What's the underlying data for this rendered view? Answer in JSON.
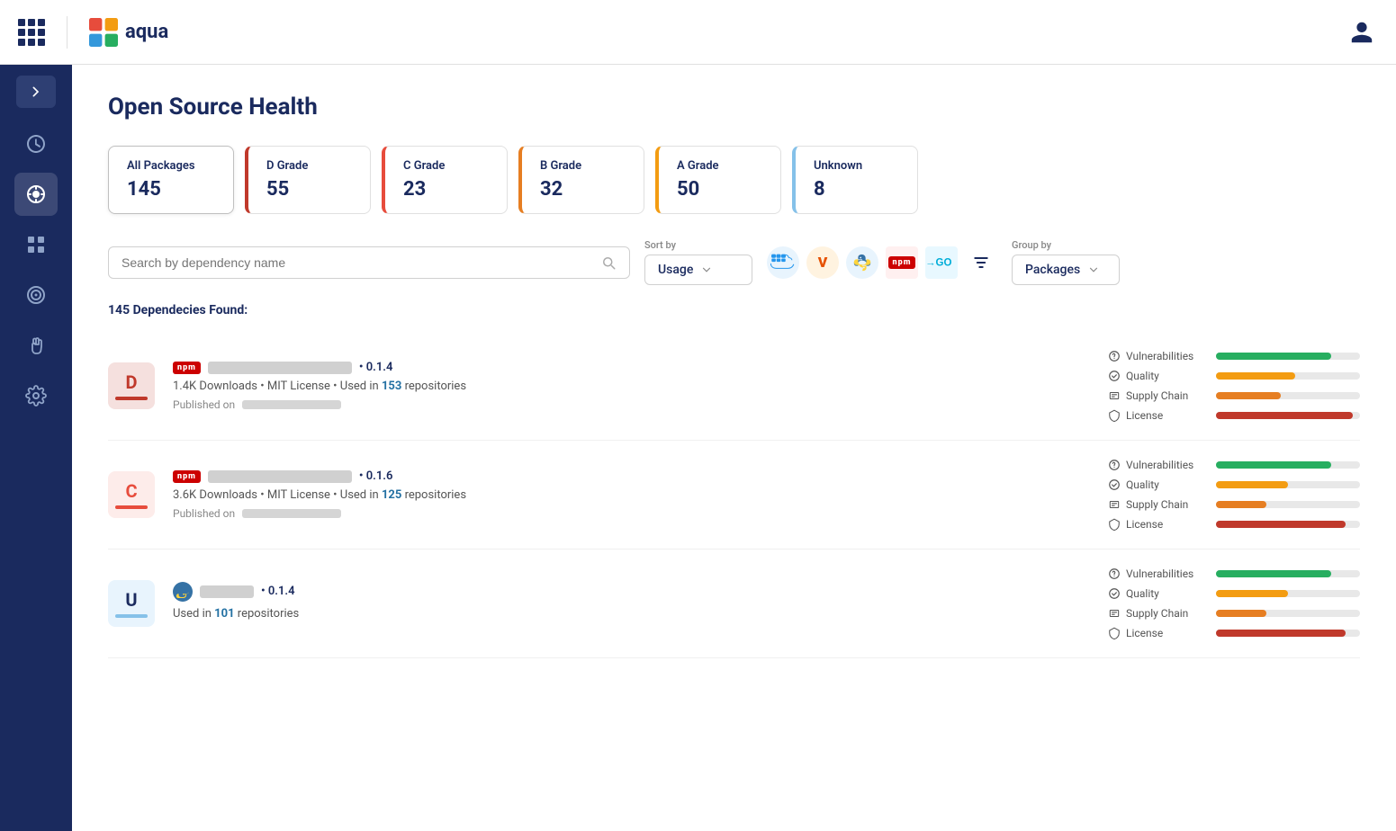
{
  "topNav": {
    "logoText": "aqua",
    "userLabel": "User Profile"
  },
  "pageTitle": "Open Source Health",
  "gradeCards": [
    {
      "id": "all",
      "label": "All Packages",
      "value": "145",
      "borderClass": "",
      "active": true
    },
    {
      "id": "d",
      "label": "D Grade",
      "value": "55",
      "borderClass": "grade-card-border-d"
    },
    {
      "id": "c",
      "label": "C Grade",
      "value": "23",
      "borderClass": "grade-card-border-c"
    },
    {
      "id": "b",
      "label": "B Grade",
      "value": "32",
      "borderClass": "grade-card-border-b"
    },
    {
      "id": "a",
      "label": "A Grade",
      "value": "50",
      "borderClass": "grade-card-border-a"
    },
    {
      "id": "u",
      "label": "Unknown",
      "value": "8",
      "borderClass": "grade-card-border-u"
    }
  ],
  "search": {
    "placeholder": "Search by dependency name"
  },
  "sortBy": {
    "label": "Sort by",
    "value": "Usage"
  },
  "groupBy": {
    "label": "Group by",
    "value": "Packages"
  },
  "resultsHeader": "145 Dependecies Found:",
  "dependencies": [
    {
      "grade": "D",
      "gradeBarColor": "#c0392b",
      "ecosystem": "npm",
      "version": "• 0.1.4",
      "downloads": "1.4K Downloads",
      "license": "MIT License",
      "usedIn": "153",
      "usedInText": "repositories",
      "publishedLabel": "Published on",
      "scores": [
        {
          "label": "Vulnerabilities",
          "color": "#27ae60",
          "width": "80%"
        },
        {
          "label": "Quality",
          "color": "#f39c12",
          "width": "55%"
        },
        {
          "label": "Supply Chain",
          "color": "#e67e22",
          "width": "45%"
        },
        {
          "label": "License",
          "color": "#c0392b",
          "width": "95%"
        }
      ]
    },
    {
      "grade": "C",
      "gradeBarColor": "#e74c3c",
      "ecosystem": "npm",
      "version": "• 0.1.6",
      "downloads": "3.6K Downloads",
      "license": "MIT License",
      "usedIn": "125",
      "usedInText": "repositories",
      "publishedLabel": "Published on",
      "scores": [
        {
          "label": "Vulnerabilities",
          "color": "#27ae60",
          "width": "80%"
        },
        {
          "label": "Quality",
          "color": "#f39c12",
          "width": "50%"
        },
        {
          "label": "Supply Chain",
          "color": "#e67e22",
          "width": "35%"
        },
        {
          "label": "License",
          "color": "#c0392b",
          "width": "90%"
        }
      ]
    },
    {
      "grade": "U",
      "gradeBarColor": "#85c1e9",
      "ecosystem": "python",
      "version": "• 0.1.4",
      "downloads": "",
      "license": "",
      "usedIn": "101",
      "usedInText": "repositories",
      "publishedLabel": "",
      "scores": [
        {
          "label": "Vulnerabilities",
          "color": "#27ae60",
          "width": "80%"
        },
        {
          "label": "Quality",
          "color": "#f39c12",
          "width": "50%"
        },
        {
          "label": "Supply Chain",
          "color": "#e67e22",
          "width": "35%"
        },
        {
          "label": "License",
          "color": "#c0392b",
          "width": "90%"
        }
      ]
    }
  ],
  "sidebar": {
    "items": [
      {
        "id": "speedometer",
        "active": false
      },
      {
        "id": "refresh-circle",
        "active": true
      },
      {
        "id": "grid",
        "active": false
      },
      {
        "id": "target",
        "active": false
      },
      {
        "id": "hand",
        "active": false
      },
      {
        "id": "settings",
        "active": false
      }
    ]
  }
}
